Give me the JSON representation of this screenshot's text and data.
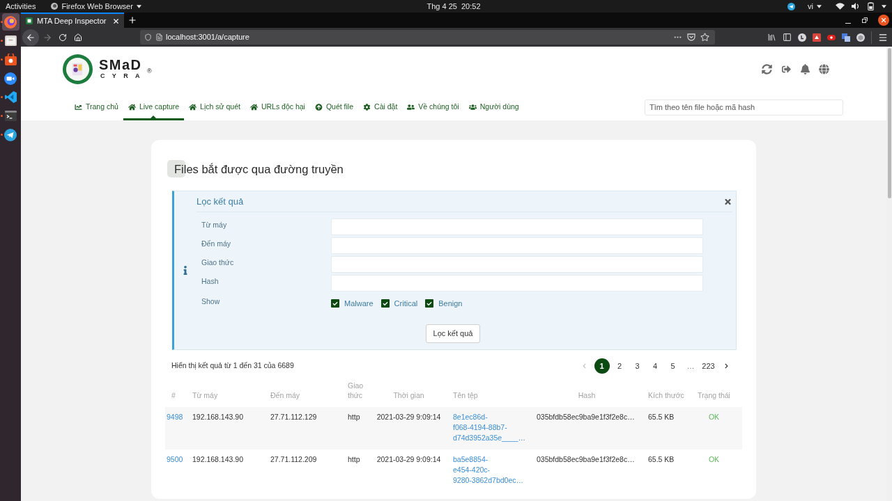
{
  "system_bar": {
    "activities": "Activities",
    "app_menu": "Firefox Web Browser",
    "clock": "Thg 4 25  20:52",
    "language": "vi"
  },
  "dock": {
    "items": [
      {
        "selected": true,
        "running": true
      },
      {
        "selected": false,
        "running": true
      },
      {
        "selected": false,
        "running": true
      },
      {
        "selected": false,
        "running": false
      },
      {
        "selected": false,
        "running": true
      },
      {
        "selected": false,
        "running": true
      },
      {
        "selected": false,
        "running": true
      }
    ]
  },
  "browser": {
    "tabs": [
      {
        "title": "MTA Deep Inspector",
        "selected": true
      }
    ],
    "forward_disabled": true,
    "address": "localhost:3001/a/capture"
  },
  "header": {
    "logo": {
      "name": "SMaD",
      "tagline": "CYRA",
      "mark": "®"
    },
    "nav": [
      {
        "label": "Trang chủ",
        "selected": false
      },
      {
        "label": "Live capture",
        "selected": true
      },
      {
        "label": "Lịch sử quét",
        "selected": false
      },
      {
        "label": "URLs độc hại",
        "selected": false
      },
      {
        "label": "Quét file",
        "selected": false
      },
      {
        "label": "Cài đặt",
        "selected": false
      },
      {
        "label": "Về chúng tôi",
        "selected": false
      },
      {
        "label": "Người dùng",
        "selected": false
      }
    ],
    "search": {
      "placeholder": "Tìm theo tên file hoặc mã hash"
    }
  },
  "content": {
    "title": "Files bắt được qua đường truyền",
    "filter": {
      "title": "Lọc kết quả",
      "fields": [
        {
          "label": "Từ máy",
          "kind": "text"
        },
        {
          "label": "Đến máy",
          "kind": "text"
        },
        {
          "label": "Giao thức",
          "kind": "text"
        },
        {
          "label": "Hash",
          "kind": "text"
        },
        {
          "label": "Show",
          "kind": "checks",
          "options": [
            {
              "label": "Malware",
              "checked": true
            },
            {
              "label": "Critical",
              "checked": true
            },
            {
              "label": "Benign",
              "checked": true
            }
          ]
        }
      ],
      "submit": "Lọc kết quả"
    },
    "summary": "Hiển thị kết quả từ 1 đến 31 của 6689",
    "pagination": {
      "prev_disabled": true,
      "pages": [
        {
          "label": "1",
          "kind": "page",
          "selected": true
        },
        {
          "label": "2",
          "kind": "page",
          "selected": false
        },
        {
          "label": "3",
          "kind": "page",
          "selected": false
        },
        {
          "label": "4",
          "kind": "page",
          "selected": false
        },
        {
          "label": "5",
          "kind": "page",
          "selected": false
        },
        {
          "label": "…",
          "kind": "gap",
          "selected": false
        },
        {
          "label": "223",
          "kind": "page",
          "selected": false
        }
      ]
    },
    "table": {
      "columns": [
        "#",
        "Từ máy",
        "Đến máy",
        "Giao thức",
        "Thời gian",
        "Tên tệp",
        "Hash",
        "Kích thước",
        "Trạng thái"
      ],
      "rows": [
        {
          "id": "9498",
          "from": "192.168.143.90",
          "to": "27.71.112.129",
          "protocol": "http",
          "time": "2021-03-29 9:09:14",
          "file_name": [
            "8e1ec86d-",
            "f068-4194-88b7-",
            "d74d3952a35e____…"
          ],
          "hash": "035bfdb58ec9ba9e1f3f2e8c…",
          "size": "65.5 KB",
          "status": "OK"
        },
        {
          "id": "9500",
          "from": "192.168.143.90",
          "to": "27.71.112.209",
          "protocol": "http",
          "time": "2021-03-29 9:09:14",
          "file_name": [
            "ba5e8854-",
            "e454-420c-",
            "9280-3862d7bd0ec…"
          ],
          "hash": "035bfdb58ec9ba9e1f3f2e8c…",
          "size": "65.5 KB",
          "status": "OK"
        }
      ]
    }
  }
}
